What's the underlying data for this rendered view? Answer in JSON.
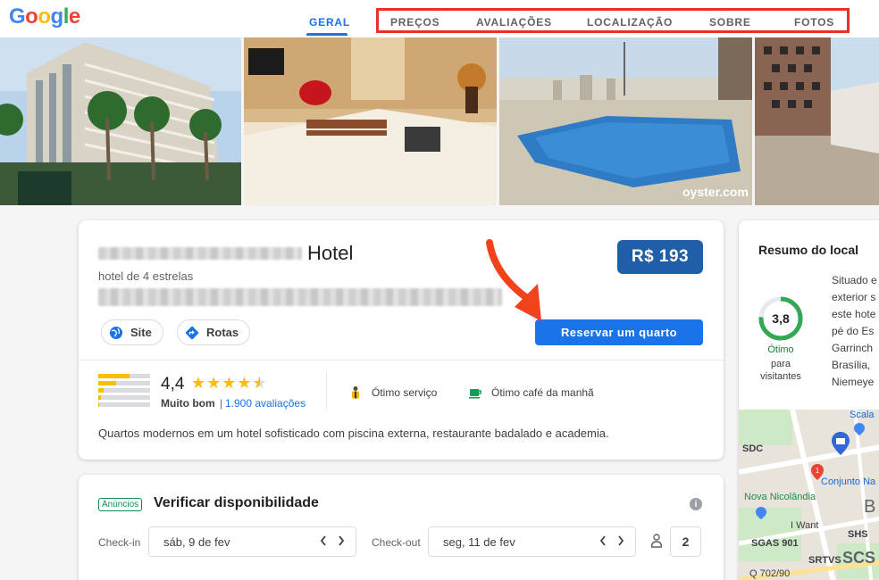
{
  "header": {
    "logo": [
      "G",
      "o",
      "o",
      "g",
      "l",
      "e"
    ],
    "tabs": [
      {
        "label": "GERAL",
        "active": true
      },
      {
        "label": "PREÇOS"
      },
      {
        "label": "AVALIAÇÕES"
      },
      {
        "label": "LOCALIZAÇÃO"
      },
      {
        "label": "SOBRE"
      },
      {
        "label": "FOTOS"
      }
    ]
  },
  "hotel": {
    "name_suffix": "Hotel",
    "stars_text": "hotel de 4 estrelas",
    "price": "R$ 193",
    "site_label": "Site",
    "directions_label": "Rotas",
    "book_label": "Reservar um quarto",
    "rating_value": "4,4",
    "rating_stars": 4.5,
    "rating_text": "Muito bom",
    "rating_separator": "|",
    "reviews_link": "1.900 avaliações",
    "amenity_service": "Ótimo serviço",
    "amenity_breakfast": "Ótimo café da manhã",
    "description": "Quartos modernos em um hotel sofisticado com piscina externa, restaurante badalado e academia."
  },
  "availability": {
    "ads_badge": "Anúncios",
    "title": "Verificar disponibilidade",
    "checkin_label": "Check-in",
    "checkin_value": "sáb, 9 de fev",
    "checkout_label": "Check-out",
    "checkout_value": "seg, 11 de fev",
    "guests": "2"
  },
  "summary": {
    "title": "Resumo do local",
    "score": "3,8",
    "score_fraction": 0.76,
    "score_label": "Ótimo",
    "score_sub": "para\nvisitantes",
    "text": "Situado e\nexterior s\neste hote\npé do Es\nGarrinch\nBrasília, \nNiemeye",
    "map_labels": [
      "Scala",
      "SDC",
      "Conjunto Na",
      "Nova Nicolândia",
      "B",
      "I Want",
      "SHS",
      "SGAS 901",
      "SRTVS",
      "SCS",
      "Q 702/90"
    ]
  },
  "watermark": "oyster.com",
  "colors": {
    "accent": "#1a73e8",
    "price": "#1f5fa8",
    "highlight": "#e8312a",
    "star": "#fbbc04",
    "good": "#188038"
  }
}
